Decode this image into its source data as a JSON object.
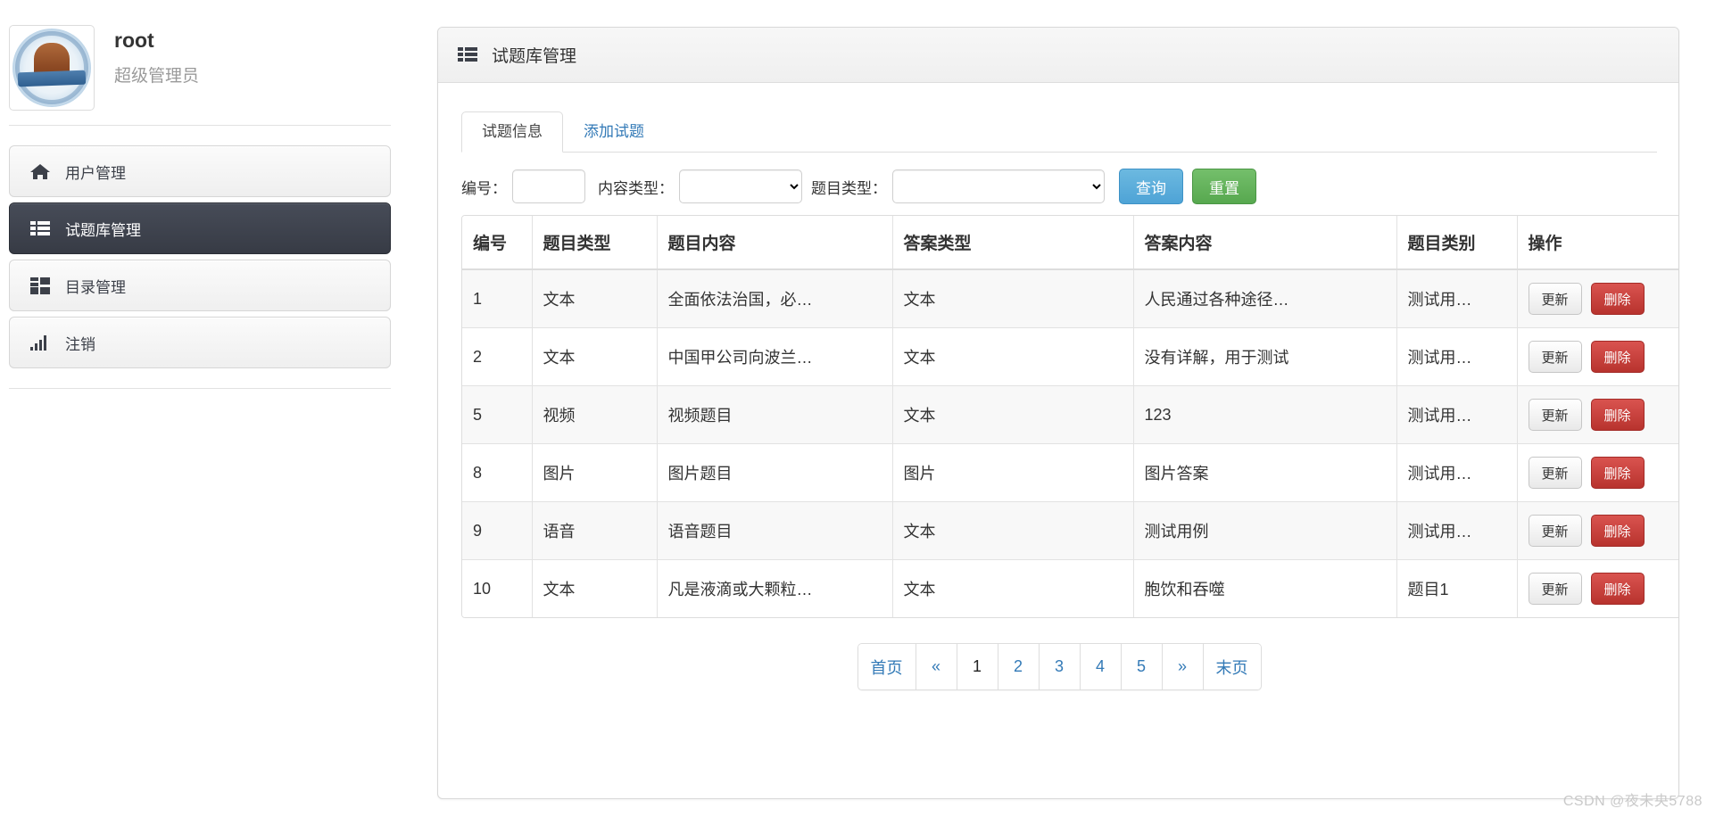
{
  "sidebar": {
    "profile": {
      "avatar_icon": "university-emblem-avatar",
      "name": "root",
      "role": "超级管理员"
    },
    "items": [
      {
        "label": "用户管理",
        "icon": "home-icon",
        "active": false
      },
      {
        "label": "试题库管理",
        "icon": "list-icon",
        "active": true
      },
      {
        "label": "目录管理",
        "icon": "grid-icon",
        "active": false
      },
      {
        "label": "注销",
        "icon": "bar-chart-icon",
        "active": false
      }
    ]
  },
  "panel": {
    "header_icon": "list-icon",
    "title": "试题库管理",
    "tabs": [
      {
        "label": "试题信息",
        "active": true
      },
      {
        "label": "添加试题",
        "active": false
      }
    ],
    "filters": {
      "id_label": "编号：",
      "id_value": "",
      "id_placeholder": "",
      "content_type_label": "内容类型：",
      "content_type_value": "",
      "question_type_label": "题目类型：",
      "question_type_value": "",
      "query_button": "查询",
      "reset_button": "重置",
      "query_color": "#4ea3d6",
      "reset_color": "#57a84f"
    },
    "table": {
      "columns": [
        "编号",
        "题目类型",
        "题目内容",
        "答案类型",
        "答案内容",
        "题目类别",
        "操作"
      ],
      "row_actions": {
        "update": "更新",
        "delete": "删除"
      },
      "rows": [
        {
          "id": "1",
          "qtype": "文本",
          "qcontent": "全面依法治国，必…",
          "atype": "文本",
          "acontent": "人民通过各种途径…",
          "category": "测试用…"
        },
        {
          "id": "2",
          "qtype": "文本",
          "qcontent": "中国甲公司向波兰…",
          "atype": "文本",
          "acontent": "没有详解，用于测试",
          "category": "测试用…"
        },
        {
          "id": "5",
          "qtype": "视频",
          "qcontent": "视频题目",
          "atype": "文本",
          "acontent": "123",
          "category": "测试用…"
        },
        {
          "id": "8",
          "qtype": "图片",
          "qcontent": "图片题目",
          "atype": "图片",
          "acontent": "图片答案",
          "category": "测试用…"
        },
        {
          "id": "9",
          "qtype": "语音",
          "qcontent": "语音题目",
          "atype": "文本",
          "acontent": "测试用例",
          "category": "测试用…"
        },
        {
          "id": "10",
          "qtype": "文本",
          "qcontent": "凡是液滴或大颗粒…",
          "atype": "文本",
          "acontent": "胞饮和吞噬",
          "category": "题目1"
        }
      ]
    },
    "pagination": {
      "items": [
        {
          "label": "首页",
          "current": false
        },
        {
          "label": "«",
          "current": false
        },
        {
          "label": "1",
          "current": true
        },
        {
          "label": "2",
          "current": false
        },
        {
          "label": "3",
          "current": false
        },
        {
          "label": "4",
          "current": false
        },
        {
          "label": "5",
          "current": false
        },
        {
          "label": "»",
          "current": false
        },
        {
          "label": "末页",
          "current": false
        }
      ]
    }
  },
  "watermark": "CSDN @夜未央5788"
}
